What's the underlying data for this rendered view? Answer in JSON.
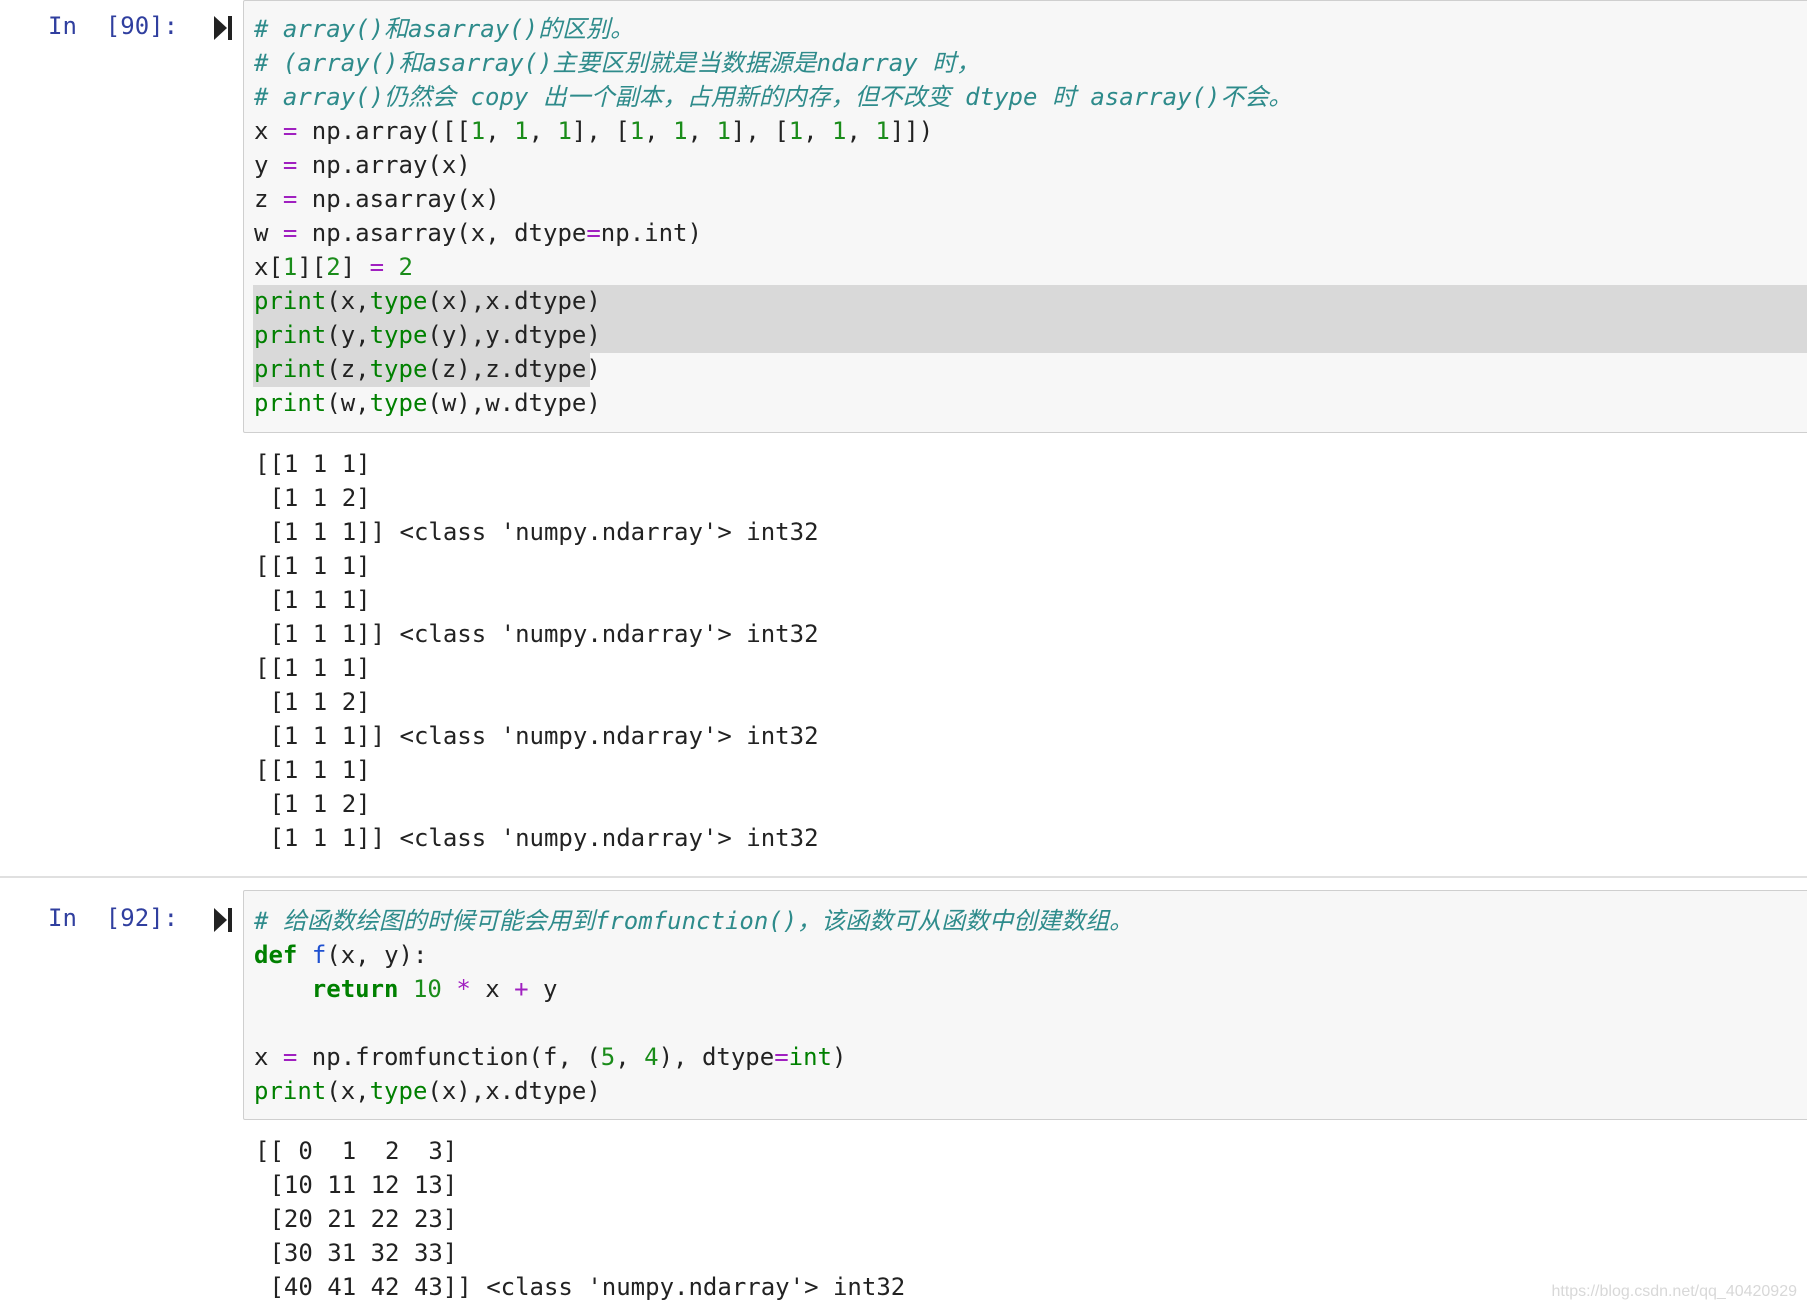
{
  "cells": [
    {
      "prompt": "In  [90]:",
      "code": [
        [
          [
            "c",
            "# array()和asarray()的区别。"
          ]
        ],
        [
          [
            "c",
            "# (array()和asarray()主要区别就是当数据源是ndarray 时，"
          ]
        ],
        [
          [
            "c",
            "# array()仍然会 copy 出一个副本，占用新的内存，但不改变 dtype 时 asarray()不会。"
          ]
        ],
        [
          [
            "t",
            "x "
          ],
          [
            "o",
            "="
          ],
          [
            "t",
            " np.array([["
          ],
          [
            "n",
            "1"
          ],
          [
            "t",
            ", "
          ],
          [
            "n",
            "1"
          ],
          [
            "t",
            ", "
          ],
          [
            "n",
            "1"
          ],
          [
            "t",
            "], ["
          ],
          [
            "n",
            "1"
          ],
          [
            "t",
            ", "
          ],
          [
            "n",
            "1"
          ],
          [
            "t",
            ", "
          ],
          [
            "n",
            "1"
          ],
          [
            "t",
            "], ["
          ],
          [
            "n",
            "1"
          ],
          [
            "t",
            ", "
          ],
          [
            "n",
            "1"
          ],
          [
            "t",
            ", "
          ],
          [
            "n",
            "1"
          ],
          [
            "t",
            "]])"
          ]
        ],
        [
          [
            "t",
            "y "
          ],
          [
            "o",
            "="
          ],
          [
            "t",
            " np.array(x)"
          ]
        ],
        [
          [
            "t",
            "z "
          ],
          [
            "o",
            "="
          ],
          [
            "t",
            " np.asarray(x)"
          ]
        ],
        [
          [
            "t",
            "w "
          ],
          [
            "o",
            "="
          ],
          [
            "t",
            " np.asarray(x, dtype"
          ],
          [
            "o",
            "="
          ],
          [
            "t",
            "np.int)"
          ]
        ],
        [
          [
            "t",
            "x["
          ],
          [
            "n",
            "1"
          ],
          [
            "t",
            "]["
          ],
          [
            "n",
            "2"
          ],
          [
            "t",
            "] "
          ],
          [
            "o",
            "="
          ],
          [
            "t",
            " "
          ],
          [
            "n",
            "2"
          ]
        ],
        [
          [
            "b",
            "print"
          ],
          [
            "t",
            "(x,"
          ],
          [
            "b",
            "type"
          ],
          [
            "t",
            "(x),x.dtype)"
          ]
        ],
        [
          [
            "b",
            "print"
          ],
          [
            "t",
            "(y,"
          ],
          [
            "b",
            "type"
          ],
          [
            "t",
            "(y),y.dtype)"
          ]
        ],
        [
          [
            "b",
            "print"
          ],
          [
            "t",
            "(z,"
          ],
          [
            "b",
            "type"
          ],
          [
            "t",
            "(z),z.dtype)"
          ]
        ],
        [
          [
            "b",
            "print"
          ],
          [
            "t",
            "(w,"
          ],
          [
            "b",
            "type"
          ],
          [
            "t",
            "(w),w.dtype)"
          ]
        ]
      ],
      "output": [
        "[[1 1 1]",
        " [1 1 2]",
        " [1 1 1]] <class 'numpy.ndarray'> int32",
        "[[1 1 1]",
        " [1 1 1]",
        " [1 1 1]] <class 'numpy.ndarray'> int32",
        "[[1 1 1]",
        " [1 1 2]",
        " [1 1 1]] <class 'numpy.ndarray'> int32",
        "[[1 1 1]",
        " [1 1 2]",
        " [1 1 1]] <class 'numpy.ndarray'> int32"
      ]
    },
    {
      "prompt": "In  [92]:",
      "code": [
        [
          [
            "c",
            "# 给函数绘图的时候可能会用到fromfunction()，该函数可从函数中创建数组。"
          ]
        ],
        [
          [
            "k",
            "def"
          ],
          [
            "t",
            " "
          ],
          [
            "fn",
            "f"
          ],
          [
            "t",
            "(x, y):"
          ]
        ],
        [
          [
            "t",
            "    "
          ],
          [
            "k",
            "return"
          ],
          [
            "t",
            " "
          ],
          [
            "n",
            "10"
          ],
          [
            "t",
            " "
          ],
          [
            "o",
            "*"
          ],
          [
            "t",
            " x "
          ],
          [
            "o",
            "+"
          ],
          [
            "t",
            " y"
          ]
        ],
        [],
        [
          [
            "t",
            "x "
          ],
          [
            "o",
            "="
          ],
          [
            "t",
            " np.fromfunction(f, ("
          ],
          [
            "n",
            "5"
          ],
          [
            "t",
            ", "
          ],
          [
            "n",
            "4"
          ],
          [
            "t",
            "), dtype"
          ],
          [
            "o",
            "="
          ],
          [
            "b",
            "int"
          ],
          [
            "t",
            ")"
          ]
        ],
        [
          [
            "b",
            "print"
          ],
          [
            "t",
            "(x,"
          ],
          [
            "b",
            "type"
          ],
          [
            "t",
            "(x),x.dtype)"
          ]
        ]
      ],
      "output": [
        "[[ 0  1  2  3]",
        " [10 11 12 13]",
        " [20 21 22 23]",
        " [30 31 32 33]",
        " [40 41 42 43]] <class 'numpy.ndarray'> int32"
      ]
    }
  ],
  "watermark": "https://blog.csdn.net/qq_40420929"
}
